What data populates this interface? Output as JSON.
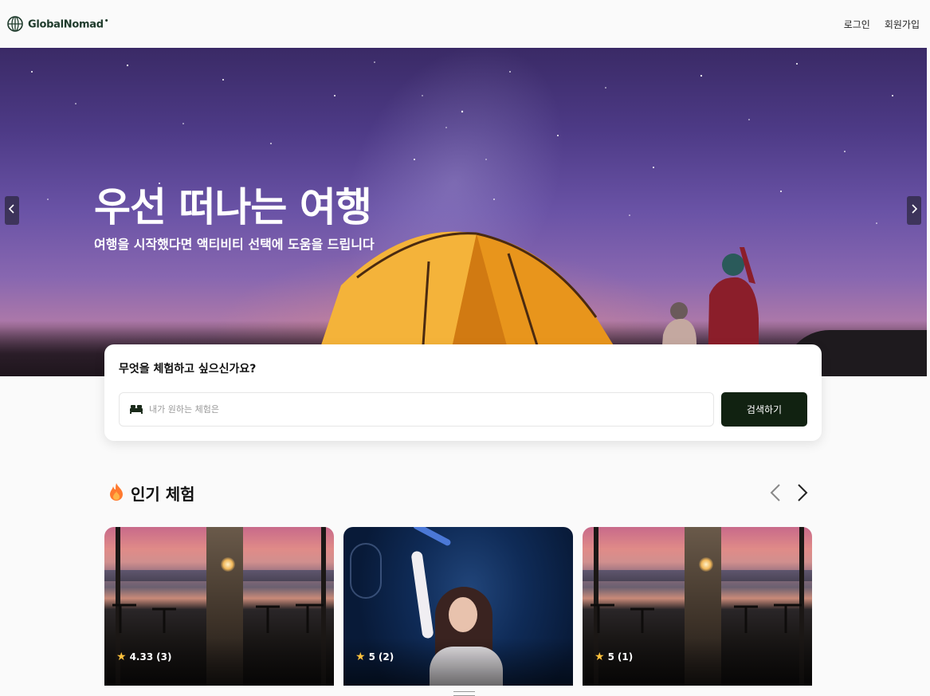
{
  "header": {
    "logo_text": "GlobalNomad",
    "logo_mark": "•",
    "nav": {
      "login": "로그인",
      "signup": "회원가입"
    }
  },
  "hero": {
    "title": "우선 떠나는 여행",
    "subtitle": "여행을 시작했다면 액티비티 선택에 도움을 드립니다",
    "prev_icon": "chevron-left-icon",
    "next_icon": "chevron-right-icon"
  },
  "search": {
    "title": "무엇을 체험하고 싶으신가요?",
    "placeholder": "내가 원하는 체험은",
    "button_label": "검색하기",
    "icon": "bed-icon"
  },
  "popular": {
    "title": "인기 체험",
    "icon": "fire-icon",
    "cards": [
      {
        "rating": "4.33",
        "count": "(3)",
        "image": "lounge"
      },
      {
        "rating": "5",
        "count": "(2)",
        "image": "concert"
      },
      {
        "rating": "5",
        "count": "(1)",
        "image": "lounge"
      }
    ]
  },
  "colors": {
    "primary_dark": "#112211",
    "star": "#ffc23d",
    "fire": "#ff7a2f"
  }
}
